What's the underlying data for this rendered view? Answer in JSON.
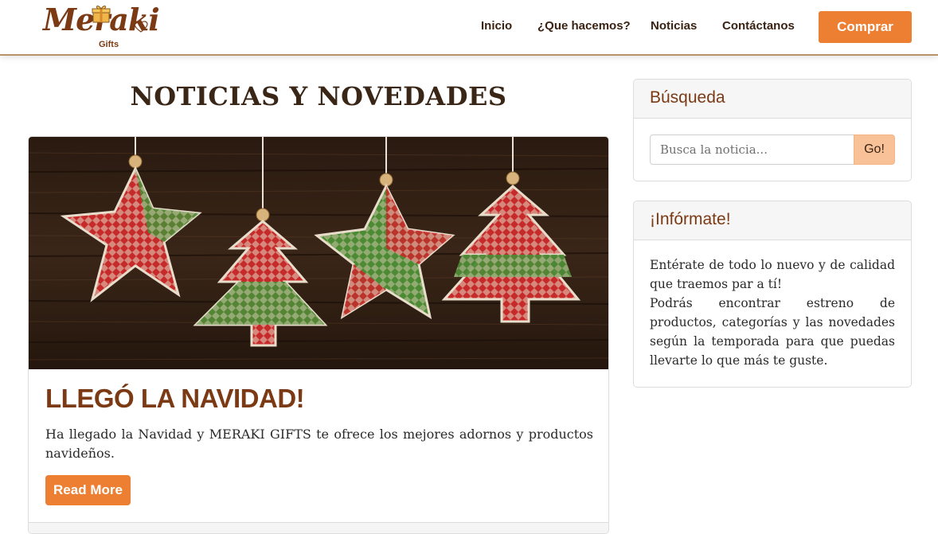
{
  "brand": {
    "name": "Meraki",
    "sub": "Gifts",
    "brown": "#7b3a14",
    "orange": "#ec7f32"
  },
  "nav": {
    "links": [
      "Inicio",
      "¿Que hacemos?",
      "Noticias",
      "Contáctanos"
    ],
    "buy_label": "Comprar"
  },
  "main": {
    "title": "NOTICIAS Y NOVEDADES",
    "post": {
      "title": "LLEGÓ LA NAVIDAD!",
      "text": "Ha llegado la Navidad y MERAKI GIFTS te ofrece los mejores adornos y productos navideños.",
      "read_more": "Read More"
    }
  },
  "sidebar": {
    "search": {
      "title": "Búsqueda",
      "placeholder": "Busca la noticia...",
      "go_label": "Go!"
    },
    "info": {
      "title": "¡Infórmate!",
      "p1": "Entérate de todo lo nuevo y de calidad que traemos par a tí!",
      "p2": "Podrás encontrar estreno de productos, categorías y las novedades según la temporada para que puedas llevarte lo que más te guste."
    }
  }
}
